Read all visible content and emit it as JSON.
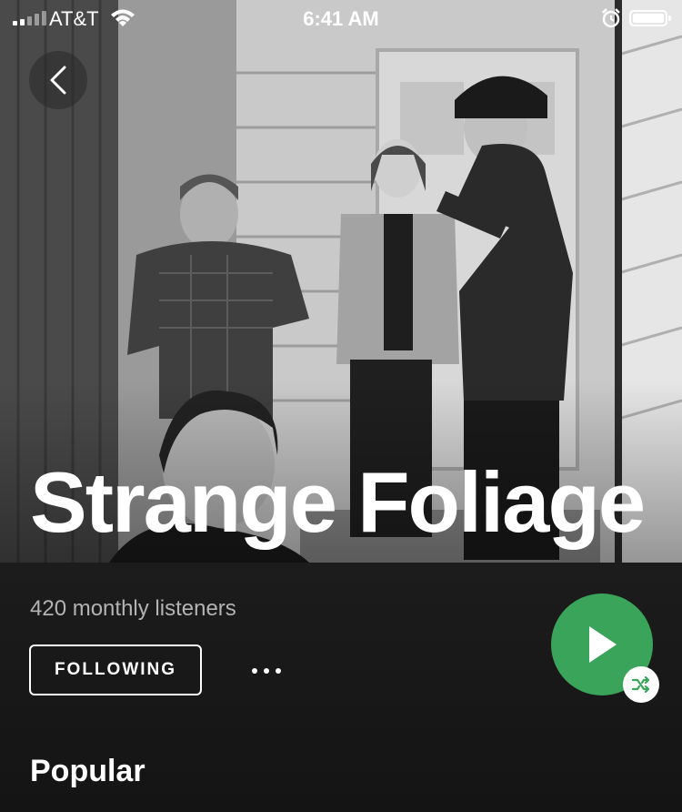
{
  "status_bar": {
    "carrier": "AT&T",
    "time": "6:41 AM",
    "signal_bars_filled": 2,
    "signal_bars_total": 5
  },
  "artist": {
    "name": "Strange Foliage",
    "monthly_listeners": "420 monthly listeners"
  },
  "actions": {
    "follow_label": "FOLLOWING",
    "more_icon": "ellipsis-icon",
    "play_icon": "play-icon",
    "shuffle_icon": "shuffle-icon"
  },
  "sections": {
    "popular_title": "Popular"
  },
  "colors": {
    "accent_green": "#3aa55a",
    "background": "#121212",
    "secondary_text": "#b3b3b3"
  }
}
